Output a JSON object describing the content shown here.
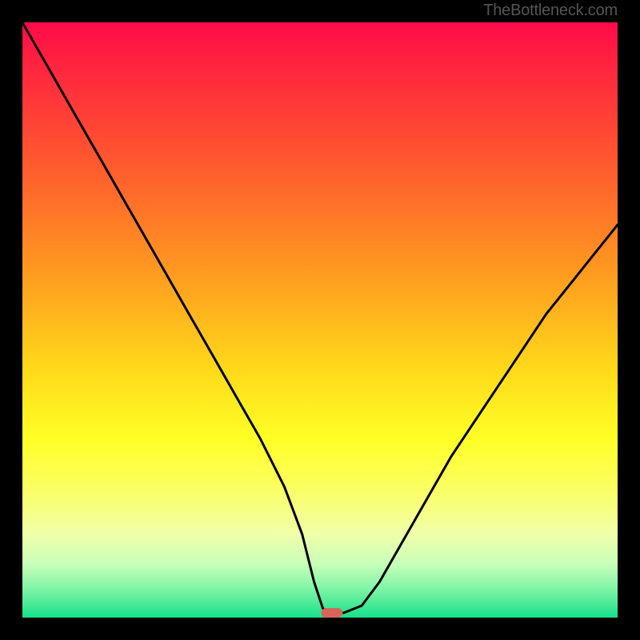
{
  "watermark": "TheBottleneck.com",
  "chart_data": {
    "type": "line",
    "title": "",
    "xlabel": "",
    "ylabel": "",
    "xlim": [
      0,
      100
    ],
    "ylim": [
      0,
      100
    ],
    "x": [
      0,
      4,
      8,
      12,
      16,
      20,
      24,
      28,
      32,
      36,
      40,
      44,
      47,
      49,
      50.5,
      52,
      54,
      57,
      60,
      64,
      68,
      72,
      76,
      80,
      84,
      88,
      92,
      96,
      100
    ],
    "y": [
      100,
      93,
      86,
      79,
      72,
      65,
      58,
      51,
      44,
      37,
      30,
      22,
      14,
      6,
      1.5,
      0.8,
      0.8,
      2,
      6,
      13,
      20,
      27,
      33,
      39,
      45,
      51,
      56,
      61,
      66
    ],
    "vertex_x": 52,
    "vertex_y": 0.8,
    "marker": {
      "shape": "pill",
      "color": "#d9655a",
      "x": 52,
      "y": 0.8,
      "width": 3.6,
      "height": 1.6
    },
    "background_gradient": {
      "top": "#ff0b4a",
      "mid_upper": "#ffd81a",
      "mid_lower": "#fbff60",
      "bottom": "#18e08a"
    }
  }
}
